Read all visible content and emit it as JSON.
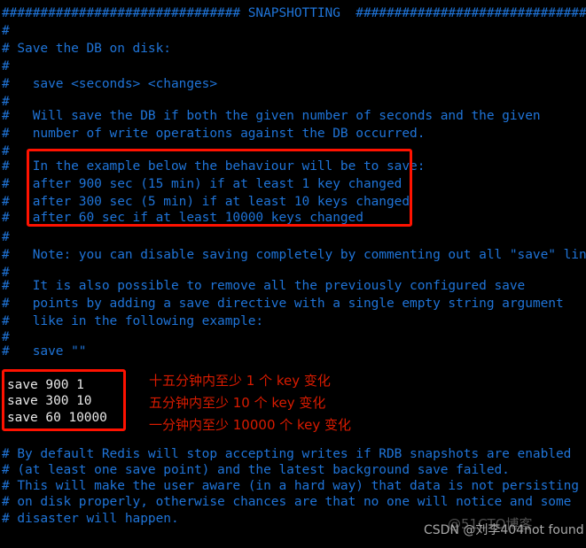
{
  "window": {
    "title": "redis.conf - SNAPSHOTTING section",
    "background_color": "#000000",
    "comment_color": "#1f74d8",
    "value_color": "#e8e8e8",
    "highlight_color": "#ff1200",
    "annotation_color": "#d91b00"
  },
  "config": {
    "lines": [
      "############################### SNAPSHOTTING  ################################",
      "#",
      "# Save the DB on disk:",
      "#",
      "#   save <seconds> <changes>",
      "#",
      "#   Will save the DB if both the given number of seconds and the given",
      "#   number of write operations against the DB occurred.",
      "#",
      "#   In the example below the behaviour will be to save:",
      "#   after 900 sec (15 min) if at least 1 key changed",
      "#   after 300 sec (5 min) if at least 10 keys changed",
      "#   after 60 sec if at least 10000 keys changed",
      "#",
      "#   Note: you can disable saving completely by commenting out all \"save\" lines.",
      "#",
      "#   It is also possible to remove all the previously configured save",
      "#   points by adding a save directive with a single empty string argument",
      "#   like in the following example:",
      "#",
      "#   save \"\""
    ]
  },
  "save_directives": {
    "lines": [
      "save 900 1",
      "save 300 10",
      "save 60 10000"
    ]
  },
  "annotations": {
    "notes": [
      "十五分钟内至少 1 个 key 变化",
      "五分钟内至少 10 个 key 变化",
      "一分钟内至少 10000 个 key 变化"
    ]
  },
  "footer": {
    "lines": [
      "# By default Redis will stop accepting writes if RDB snapshots are enabled",
      "# (at least one save point) and the latest background save failed.",
      "# This will make the user aware (in a hard way) that data is not persisting",
      "# on disk properly, otherwise chances are that no one will notice and some",
      "# disaster will happen."
    ]
  },
  "watermarks": {
    "primary": "CSDN @刘李404not found",
    "secondary": "@51CTO博客"
  }
}
